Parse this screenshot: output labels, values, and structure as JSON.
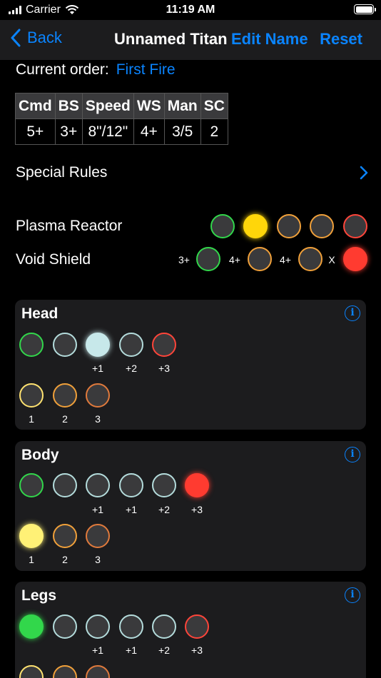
{
  "status_bar": {
    "carrier": "Carrier",
    "time": "11:19 AM"
  },
  "nav": {
    "back_label": "Back",
    "title": "Unnamed Titan",
    "edit_label": "Edit Name",
    "reset_label": "Reset"
  },
  "order": {
    "label": "Current order:",
    "value": "First Fire"
  },
  "stats": {
    "headers": [
      "Cmd",
      "BS",
      "Speed",
      "WS",
      "Man",
      "SC"
    ],
    "values": [
      "5+",
      "3+",
      "8\"/12\"",
      "4+",
      "3/5",
      "2"
    ]
  },
  "special_rules_label": "Special Rules",
  "plasma_reactor": {
    "label": "Plasma Reactor",
    "level": 2
  },
  "void_shield": {
    "label": "Void Shield",
    "thresholds": [
      "3+",
      "4+",
      "4+",
      "X"
    ]
  },
  "locations": [
    {
      "name": "Head",
      "armour_mods": [
        "+1",
        "+2",
        "+3"
      ],
      "crit_labels": [
        "1",
        "2",
        "3"
      ]
    },
    {
      "name": "Body",
      "armour_mods": [
        "+1",
        "+1",
        "+2",
        "+3"
      ],
      "crit_labels": [
        "1",
        "2",
        "3"
      ]
    },
    {
      "name": "Legs",
      "armour_mods": [
        "+1",
        "+1",
        "+2",
        "+3"
      ]
    }
  ],
  "icons": {
    "info": "i"
  }
}
